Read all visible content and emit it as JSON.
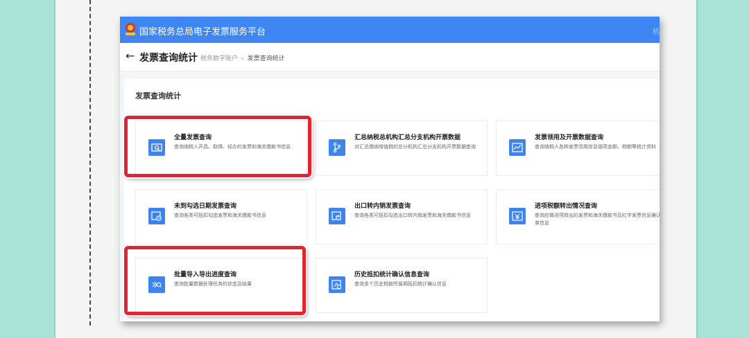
{
  "window": {
    "platform_title": "国家税务总局电子发票服务平台",
    "topbar_right": "机"
  },
  "header": {
    "page_title": "发票查询统计",
    "breadcrumb": [
      "税务数字账户",
      "发票查询统计"
    ]
  },
  "section": {
    "title": "发票查询统计"
  },
  "cards": [
    {
      "title": "全量发票查询",
      "desc": "查询纳税人开具、取得、经办的发票和海关缴款书信息",
      "icon": "search-icon"
    },
    {
      "title": "汇总纳税总机构汇总分支机构开票数据",
      "desc": "对汇总缴纳增值税的总分机构汇总分支机构开票数据查询",
      "icon": "branch-icon"
    },
    {
      "title": "发票领用及开票数据查询",
      "desc": "查询纳税人各种发票领用存及销项金额、税额等统计资料",
      "icon": "chart-icon"
    },
    {
      "title": "未到勾选日期发票查询",
      "desc": "查询各类可抵扣勾选发票和海关缴款书信息",
      "icon": "clock-icon"
    },
    {
      "title": "出口转内销发票查询",
      "desc": "查询各类可抵扣勾选出口转内销发票和海关缴款书信息",
      "icon": "return-icon"
    },
    {
      "title": "进项税额转出情况查询",
      "desc": "查询应做进项转出的发票和海关缴款书及红字发票信息确认单信息",
      "icon": "yen-icon"
    },
    {
      "title": "批量导入导出进度查询",
      "desc": "查询批量数据处理任务的状态及结果",
      "icon": "progress-icon"
    },
    {
      "title": "历史抵扣统计确认信息查询",
      "desc": "查询多个历史税款所属期抵扣统计确认信息",
      "icon": "history-icon"
    }
  ],
  "colors": {
    "primary_blue": "#3d86f4",
    "icon_blue": "#3f84ea",
    "highlight_red": "#e02434",
    "background_teal": "#a9e3d8"
  }
}
